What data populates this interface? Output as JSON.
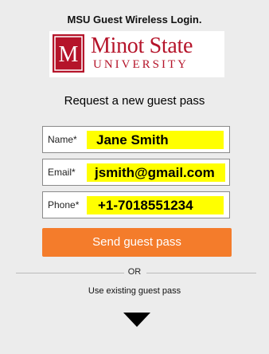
{
  "header": {
    "title": "MSU Guest Wireless Login."
  },
  "logo": {
    "line1": "Minot State",
    "line2": "UNIVERSITY",
    "mark_letter": "M",
    "brand_color": "#b5142a"
  },
  "form": {
    "title": "Request a new guest pass",
    "fields": [
      {
        "label": "Name*",
        "value": "Jane Smith"
      },
      {
        "label": "Email*",
        "value": "jsmith@gmail.com"
      },
      {
        "label": "Phone*",
        "value": "+1-7018551234"
      }
    ],
    "submit_label": "Send guest pass",
    "submit_color": "#f47c2b",
    "highlight_color": "#ffff00"
  },
  "alternate": {
    "or_label": "OR",
    "existing_label": "Use existing guest pass",
    "expand_icon": "chevron-down-icon"
  }
}
